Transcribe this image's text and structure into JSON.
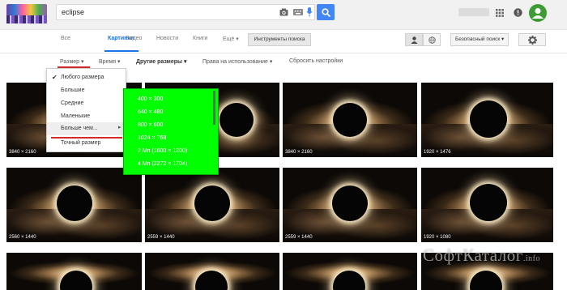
{
  "search": {
    "value": "eclipse"
  },
  "tabs": [
    {
      "label": "Все"
    },
    {
      "label": "Картинки"
    },
    {
      "label": "Видео"
    },
    {
      "label": "Новости"
    },
    {
      "label": "Книги"
    },
    {
      "label": "Ещё ▾"
    }
  ],
  "tools_button": "Инструменты поиска",
  "safe_search": "Безопасный поиск ▾",
  "tools": [
    {
      "label": "Размер ▾"
    },
    {
      "label": "Время ▾"
    },
    {
      "label": "Другие размеры ▾"
    },
    {
      "label": "Права на использование ▾"
    },
    {
      "label": "Сбросить настройки"
    }
  ],
  "size_menu": {
    "items": [
      "Любого размера",
      "Большие",
      "Средние",
      "Маленькие",
      "Больше чем...",
      "Точный размер"
    ],
    "checked_index": 0,
    "highlighted_index": 4
  },
  "larger_than_menu": {
    "items": [
      "400 × 300",
      "640 × 480",
      "800 × 600",
      "1024 × 768",
      "2 Мп (1600 × 1200)",
      "4 Мп (2272 × 1704)"
    ]
  },
  "images": [
    {
      "size": "3840 × 2160"
    },
    {
      "size": ""
    },
    {
      "size": "3840 × 2160"
    },
    {
      "size": "1920 × 1476"
    },
    {
      "size": "2560 × 1440"
    },
    {
      "size": "2559 × 1440"
    },
    {
      "size": "2559 × 1440"
    },
    {
      "size": "1920 × 1080"
    }
  ],
  "avatar_letter": "G",
  "watermark": {
    "main": "СофтКаталог",
    "suffix": ".info"
  },
  "colors": {
    "accent": "#1a73e8",
    "search_button": "#4285f4",
    "submenu": "#00ff00",
    "underline": "#d42a2a",
    "avatar": "#3f9c35"
  }
}
